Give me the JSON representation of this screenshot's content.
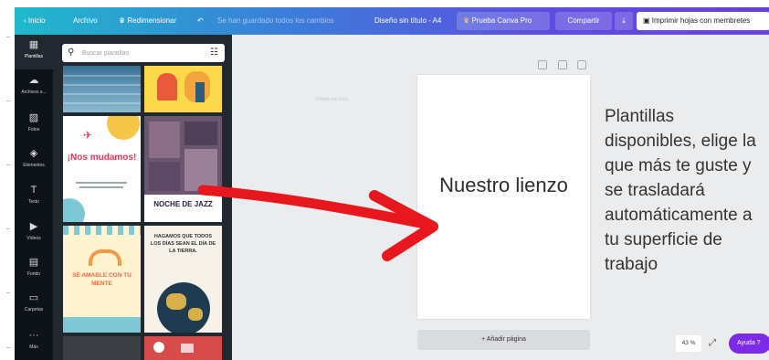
{
  "topbar": {
    "home": "Inicio",
    "file": "Archivo",
    "resize": "Redimensionar",
    "saved_status": "Se han guardado todos los cambios",
    "doc_title": "Diseño sin título - A4",
    "pro_label": "Prueba Canva Pro",
    "share": "Compartir",
    "print_label": "Imprimir hojas con membretes",
    "more": "···"
  },
  "sidebar": {
    "items": [
      {
        "label": "Plantillas",
        "icon": "templates-icon"
      },
      {
        "label": "Archivos s...",
        "icon": "cloud-upload-icon"
      },
      {
        "label": "Fotos",
        "icon": "photo-icon"
      },
      {
        "label": "Elementos",
        "icon": "shapes-icon"
      },
      {
        "label": "Texto",
        "icon": "text-icon"
      },
      {
        "label": "Vídeos",
        "icon": "video-icon"
      },
      {
        "label": "Fondo",
        "icon": "background-icon"
      },
      {
        "label": "Carpetas",
        "icon": "folder-icon"
      },
      {
        "label": "Más",
        "icon": "more-icon"
      }
    ]
  },
  "panel": {
    "search_placeholder": "Buscar plantillas",
    "templates": [
      {
        "title": "¡Nos mudamos!"
      },
      {
        "title": "NOCHE DE JAZZ"
      },
      {
        "title": "SÉ AMABLE CON TU MENTE"
      },
      {
        "title": "HAGAMOS QUE TODOS LOS DÍAS SEAN EL DÍA DE LA TIERRA."
      }
    ]
  },
  "canvas": {
    "ghost_title": "Diseño sin título",
    "page_title": "Nuestro lienzo",
    "add_page": "+ Añadir página",
    "caption": "Plantillas disponibles, elige la que más te guste y se trasladará automáticamente a tu superficie de trabajo",
    "zoom": "43 %",
    "help": "Ayuda ?"
  },
  "colors": {
    "topbar_start": "#20b9cc",
    "topbar_end": "#6b3fe0",
    "sidebar_bg": "#0e1318",
    "panel_bg": "#22282f",
    "help_button": "#7d2ae8",
    "annotation_arrow": "#e8161d"
  }
}
